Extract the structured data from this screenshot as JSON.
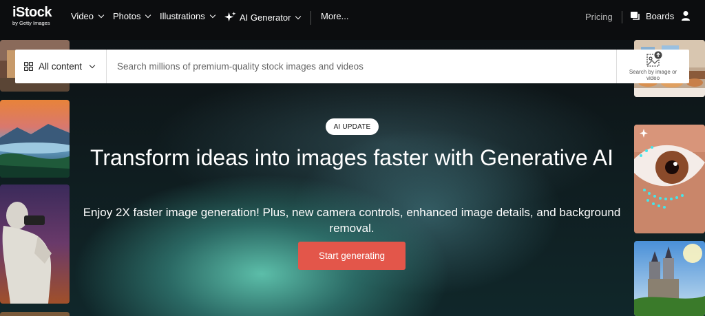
{
  "logo": {
    "brand": "iStock",
    "sub": "by Getty Images"
  },
  "nav": {
    "items": [
      {
        "label": "Video"
      },
      {
        "label": "Photos"
      },
      {
        "label": "Illustrations"
      },
      {
        "label": "AI Generator"
      },
      {
        "label": "More..."
      }
    ],
    "pricing": "Pricing",
    "boards": "Boards"
  },
  "search": {
    "scope_label": "All content",
    "placeholder": "Search millions of premium-quality stock images and videos",
    "image_search_label": "Search by image or video"
  },
  "hero": {
    "badge": "AI UPDATE",
    "headline": "Transform ideas into images faster with Generative AI",
    "subline": "Enjoy 2X faster image generation! Plus, new camera controls, enhanced image details, and background removal.",
    "cta": "Start generating"
  },
  "colors": {
    "accent": "#e3564a",
    "nav_bg": "#0c0d0f"
  }
}
